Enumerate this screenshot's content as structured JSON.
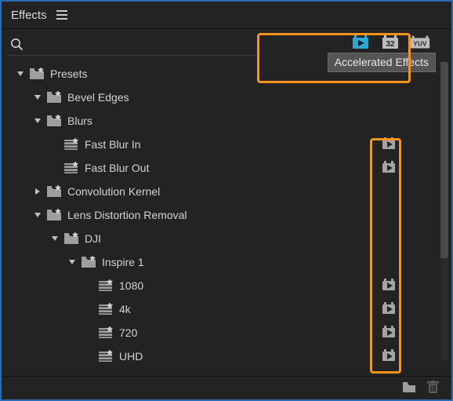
{
  "panel": {
    "title": "Effects"
  },
  "search": {
    "placeholder": ""
  },
  "badges": {
    "accelerated_tooltip": "Accelerated Effects",
    "accel_name": "accelerated-effects-badge",
    "bit32_name": "32-bit-badge",
    "bit32_label": "32",
    "yuv_name": "yuv-badge",
    "yuv_label": "YUV"
  },
  "tree": [
    {
      "depth": 0,
      "type": "folder",
      "open": true,
      "star": true,
      "label": "Presets",
      "accel": false
    },
    {
      "depth": 1,
      "type": "folder",
      "open": true,
      "star": true,
      "label": "Bevel Edges",
      "accel": false
    },
    {
      "depth": 1,
      "type": "folder",
      "open": true,
      "star": true,
      "label": "Blurs",
      "accel": false
    },
    {
      "depth": 2,
      "type": "preset",
      "open": false,
      "star": true,
      "label": "Fast Blur In",
      "accel": true
    },
    {
      "depth": 2,
      "type": "preset",
      "open": false,
      "star": true,
      "label": "Fast Blur Out",
      "accel": true
    },
    {
      "depth": 1,
      "type": "folder",
      "open": false,
      "caret": true,
      "star": true,
      "label": "Convolution Kernel",
      "accel": false
    },
    {
      "depth": 1,
      "type": "folder",
      "open": true,
      "star": true,
      "label": "Lens Distortion Removal",
      "accel": false
    },
    {
      "depth": 2,
      "type": "folder",
      "open": true,
      "star": true,
      "label": "DJI",
      "accel": false
    },
    {
      "depth": 3,
      "type": "folder",
      "open": true,
      "star": true,
      "label": "Inspire 1",
      "accel": false
    },
    {
      "depth": 4,
      "type": "preset",
      "open": false,
      "star": true,
      "label": "1080",
      "accel": true
    },
    {
      "depth": 4,
      "type": "preset",
      "open": false,
      "star": true,
      "label": "4k",
      "accel": true
    },
    {
      "depth": 4,
      "type": "preset",
      "open": false,
      "star": true,
      "label": "720",
      "accel": true
    },
    {
      "depth": 4,
      "type": "preset",
      "open": false,
      "star": true,
      "label": "UHD",
      "accel": true
    }
  ],
  "footer": {
    "new_folder_name": "new-folder-icon",
    "delete_name": "delete-icon"
  },
  "colors": {
    "accent_highlight": "#f7931e",
    "accel_blue": "#2fa7d6",
    "panel_bg": "#232323",
    "outer_border": "#2a6bb3"
  }
}
